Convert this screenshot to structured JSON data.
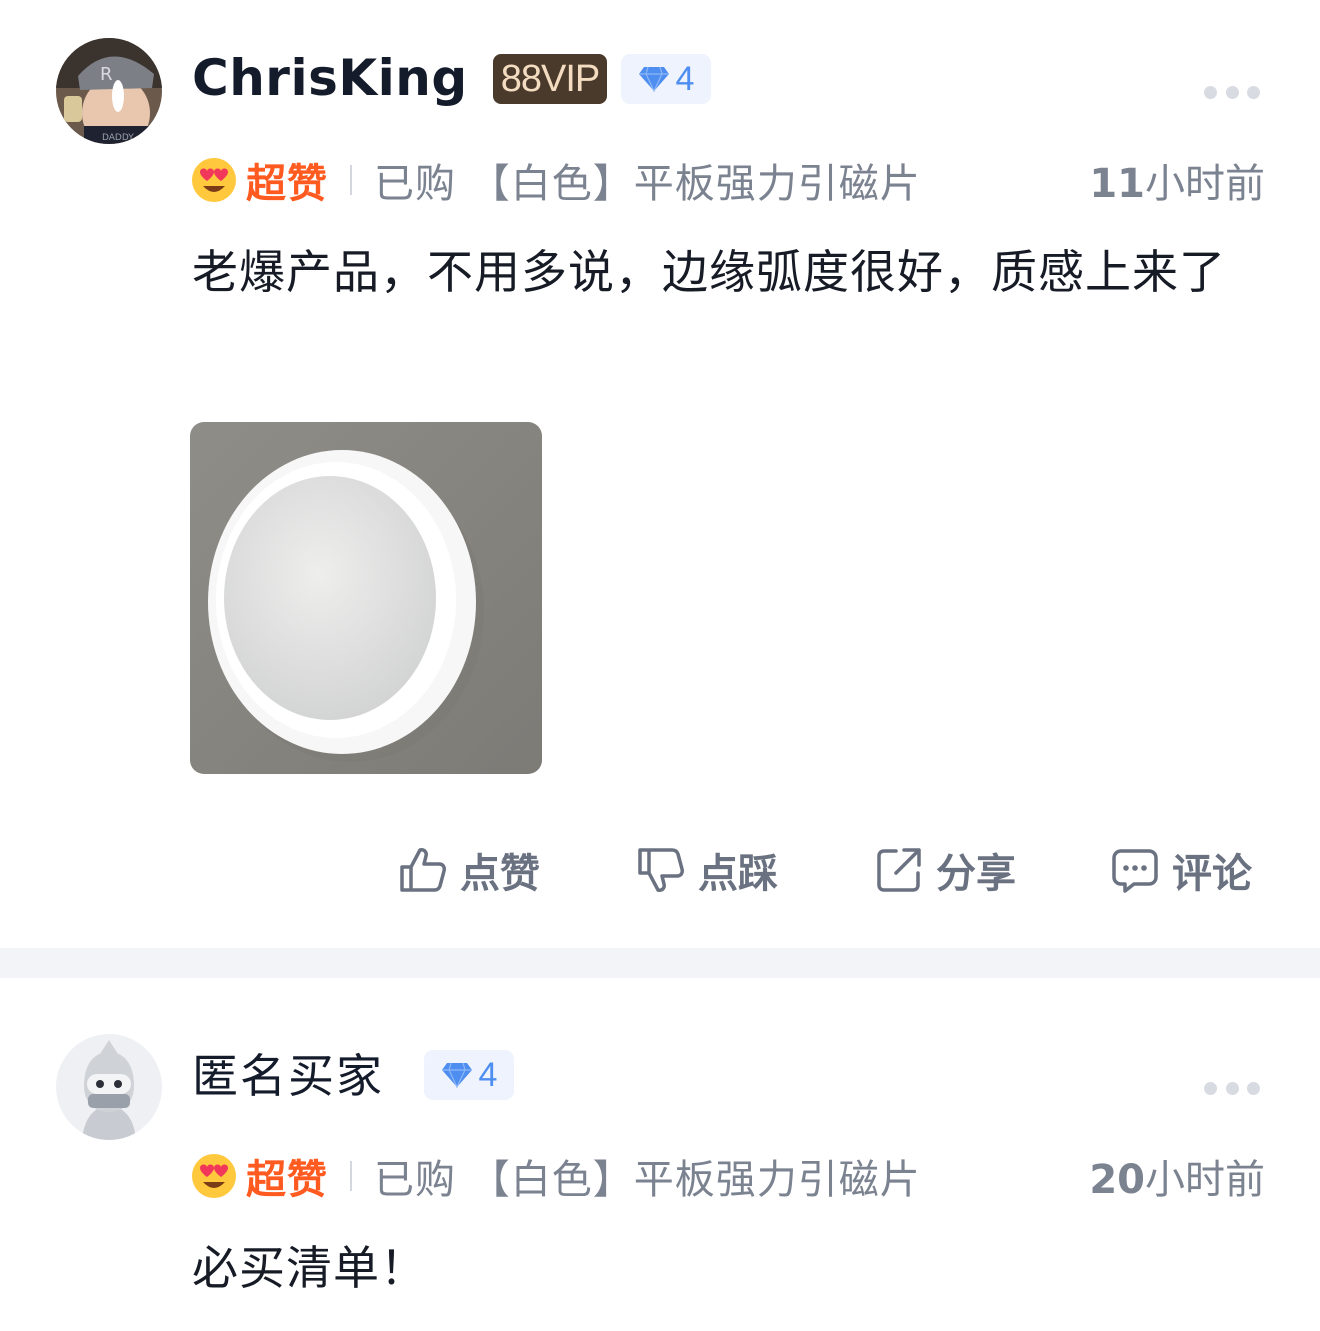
{
  "reviews": [
    {
      "username": "ChrisKing",
      "vip_badge": "88VIP",
      "level": "4",
      "rating_label": "超赞",
      "purchase_info": "已购 【白色】平板强力引磁片",
      "time_number": "11",
      "time_unit": "小时前",
      "comment": "老爆产品，不用多说，边缘弧度很好，质感上来了",
      "actions": {
        "like": "点赞",
        "dislike": "点踩",
        "share": "分享",
        "comment": "评论"
      }
    },
    {
      "username": "匿名买家",
      "level": "4",
      "rating_label": "超赞",
      "purchase_info": "已购 【白色】平板强力引磁片",
      "time_number": "20",
      "time_unit": "小时前",
      "comment": "必买清单！"
    }
  ],
  "icons": {
    "more": "more-dots-icon",
    "level": "diamond-icon",
    "rating": "heart-eyes-emoji-icon",
    "like": "thumbs-up-icon",
    "dislike": "thumbs-down-icon",
    "share": "share-icon",
    "comment": "comment-bubble-icon"
  },
  "colors": {
    "rating_accent": "#ff5a1f",
    "level_accent": "#4d8ef0",
    "vip_background": "#4a3a2b",
    "separator": "#f3f4f7"
  }
}
